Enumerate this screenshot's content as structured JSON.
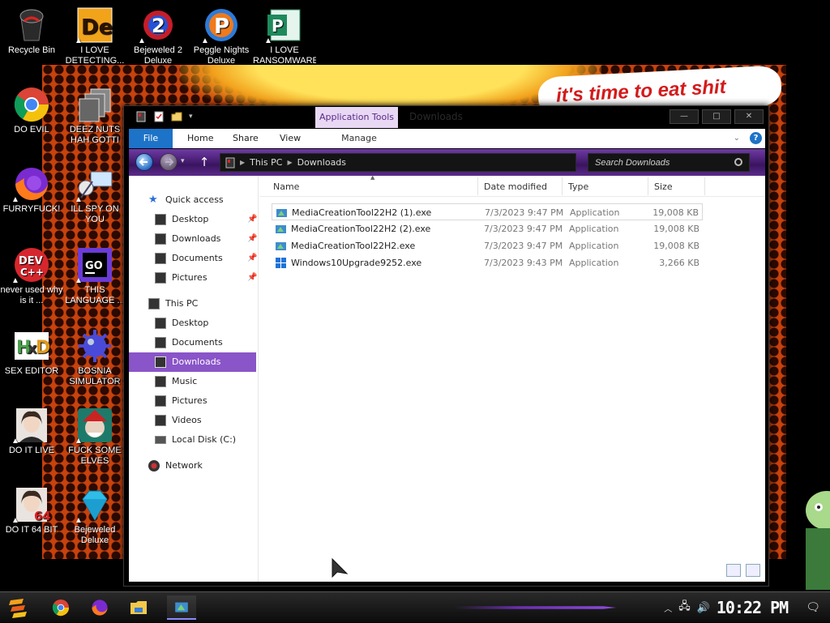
{
  "wallpaper": {
    "caption": "it's time to eat shit"
  },
  "desktop_icons": [
    {
      "label": "Recycle Bin",
      "icon": "recycle-bin-icon"
    },
    {
      "label": "I LOVE DETECTING...",
      "icon": "detect-it-easy-icon"
    },
    {
      "label": "Bejeweled 2 Deluxe",
      "icon": "bejeweled-2-icon"
    },
    {
      "label": "Peggle Nights Deluxe",
      "icon": "peggle-icon"
    },
    {
      "label": "I LOVE RANSOMWARE",
      "icon": "publisher-icon"
    },
    {
      "label": "DO EVIL",
      "icon": "chrome-icon"
    },
    {
      "label": "DEEZ NUTS HAH GOTTI",
      "icon": "copy-files-icon"
    },
    {
      "label": "FURRYFUCK!",
      "icon": "firefox-icon"
    },
    {
      "label": "ILL SPY ON YOU",
      "icon": "network-spy-icon"
    },
    {
      "label": "never used why is it ...",
      "icon": "dev-cpp-icon"
    },
    {
      "label": "THIS LANGUAGE ...",
      "icon": "goland-icon"
    },
    {
      "label": "SEX EDITOR",
      "icon": "hxd-icon"
    },
    {
      "label": "BOSNIA SIMULATOR",
      "icon": "mine-icon"
    },
    {
      "label": "DO IT LIVE",
      "icon": "portrait-icon"
    },
    {
      "label": "FUCK SOME ELVES",
      "icon": "elf-icon"
    },
    {
      "label": "DO IT 64 BIT",
      "icon": "portrait-64-icon"
    },
    {
      "label": "Bejeweled Deluxe",
      "icon": "gem-icon"
    }
  ],
  "window": {
    "title": "Downloads",
    "context_tab": "Application Tools",
    "ribbon_tabs": [
      "File",
      "Home",
      "Share",
      "View"
    ],
    "context_subtab": "Manage",
    "address": [
      "This PC",
      "Downloads"
    ],
    "search_placeholder": "Search Downloads",
    "nav": {
      "quick_access": "Quick access",
      "quick_items": [
        "Desktop",
        "Downloads",
        "Documents",
        "Pictures"
      ],
      "this_pc": "This PC",
      "pc_items": [
        "Desktop",
        "Documents",
        "Downloads",
        "Music",
        "Pictures",
        "Videos",
        "Local Disk (C:)"
      ],
      "network": "Network"
    },
    "columns": [
      "Name",
      "Date modified",
      "Type",
      "Size"
    ],
    "files": [
      {
        "name": "MediaCreationTool22H2 (1).exe",
        "date": "7/3/2023 9:47 PM",
        "type": "Application",
        "size": "19,008 KB",
        "icon": "media-creation-tool-icon"
      },
      {
        "name": "MediaCreationTool22H2 (2).exe",
        "date": "7/3/2023 9:47 PM",
        "type": "Application",
        "size": "19,008 KB",
        "icon": "media-creation-tool-icon"
      },
      {
        "name": "MediaCreationTool22H2.exe",
        "date": "7/3/2023 9:47 PM",
        "type": "Application",
        "size": "19,008 KB",
        "icon": "media-creation-tool-icon"
      },
      {
        "name": "Windows10Upgrade9252.exe",
        "date": "7/3/2023 9:43 PM",
        "type": "Application",
        "size": "3,266 KB",
        "icon": "windows-logo-icon"
      }
    ]
  },
  "taskbar": {
    "clock": "10:22 PM"
  },
  "colors": {
    "selection": "#8a55c8",
    "file_tab": "#1d73c8",
    "nav_purple": "#5b2c8a"
  }
}
